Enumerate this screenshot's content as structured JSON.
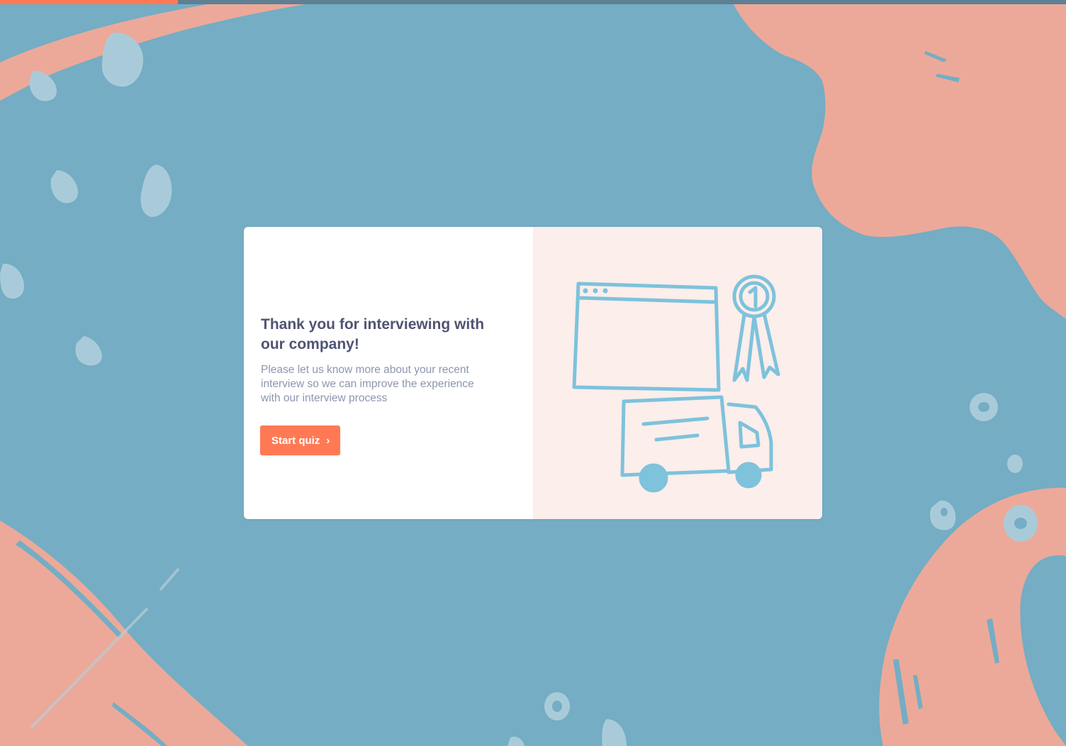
{
  "progress": {
    "fraction": 0.167,
    "track_color": "#5f7f93",
    "fill_color": "#ff7a54"
  },
  "colors": {
    "background": "#74adc4",
    "blob": "#eca999",
    "fleck": "#a9cbd9",
    "card": "#ffffff",
    "illustration_panel": "#fbeeeb",
    "illustration_stroke": "#7ec2dc",
    "title": "#4f5473",
    "description": "#8c96ae",
    "button": "#ff7a54"
  },
  "intro": {
    "title": "Thank you for interviewing with our company!",
    "description": "Please let us know more about your recent interview so we can improve the experience with our interview process",
    "start_label": "Start quiz",
    "start_icon": "chevron-right-icon",
    "start_icon_glyph": "›"
  },
  "illustration": {
    "subject": "browser window, award ribbon and delivery truck",
    "ribbon_number": "1"
  }
}
